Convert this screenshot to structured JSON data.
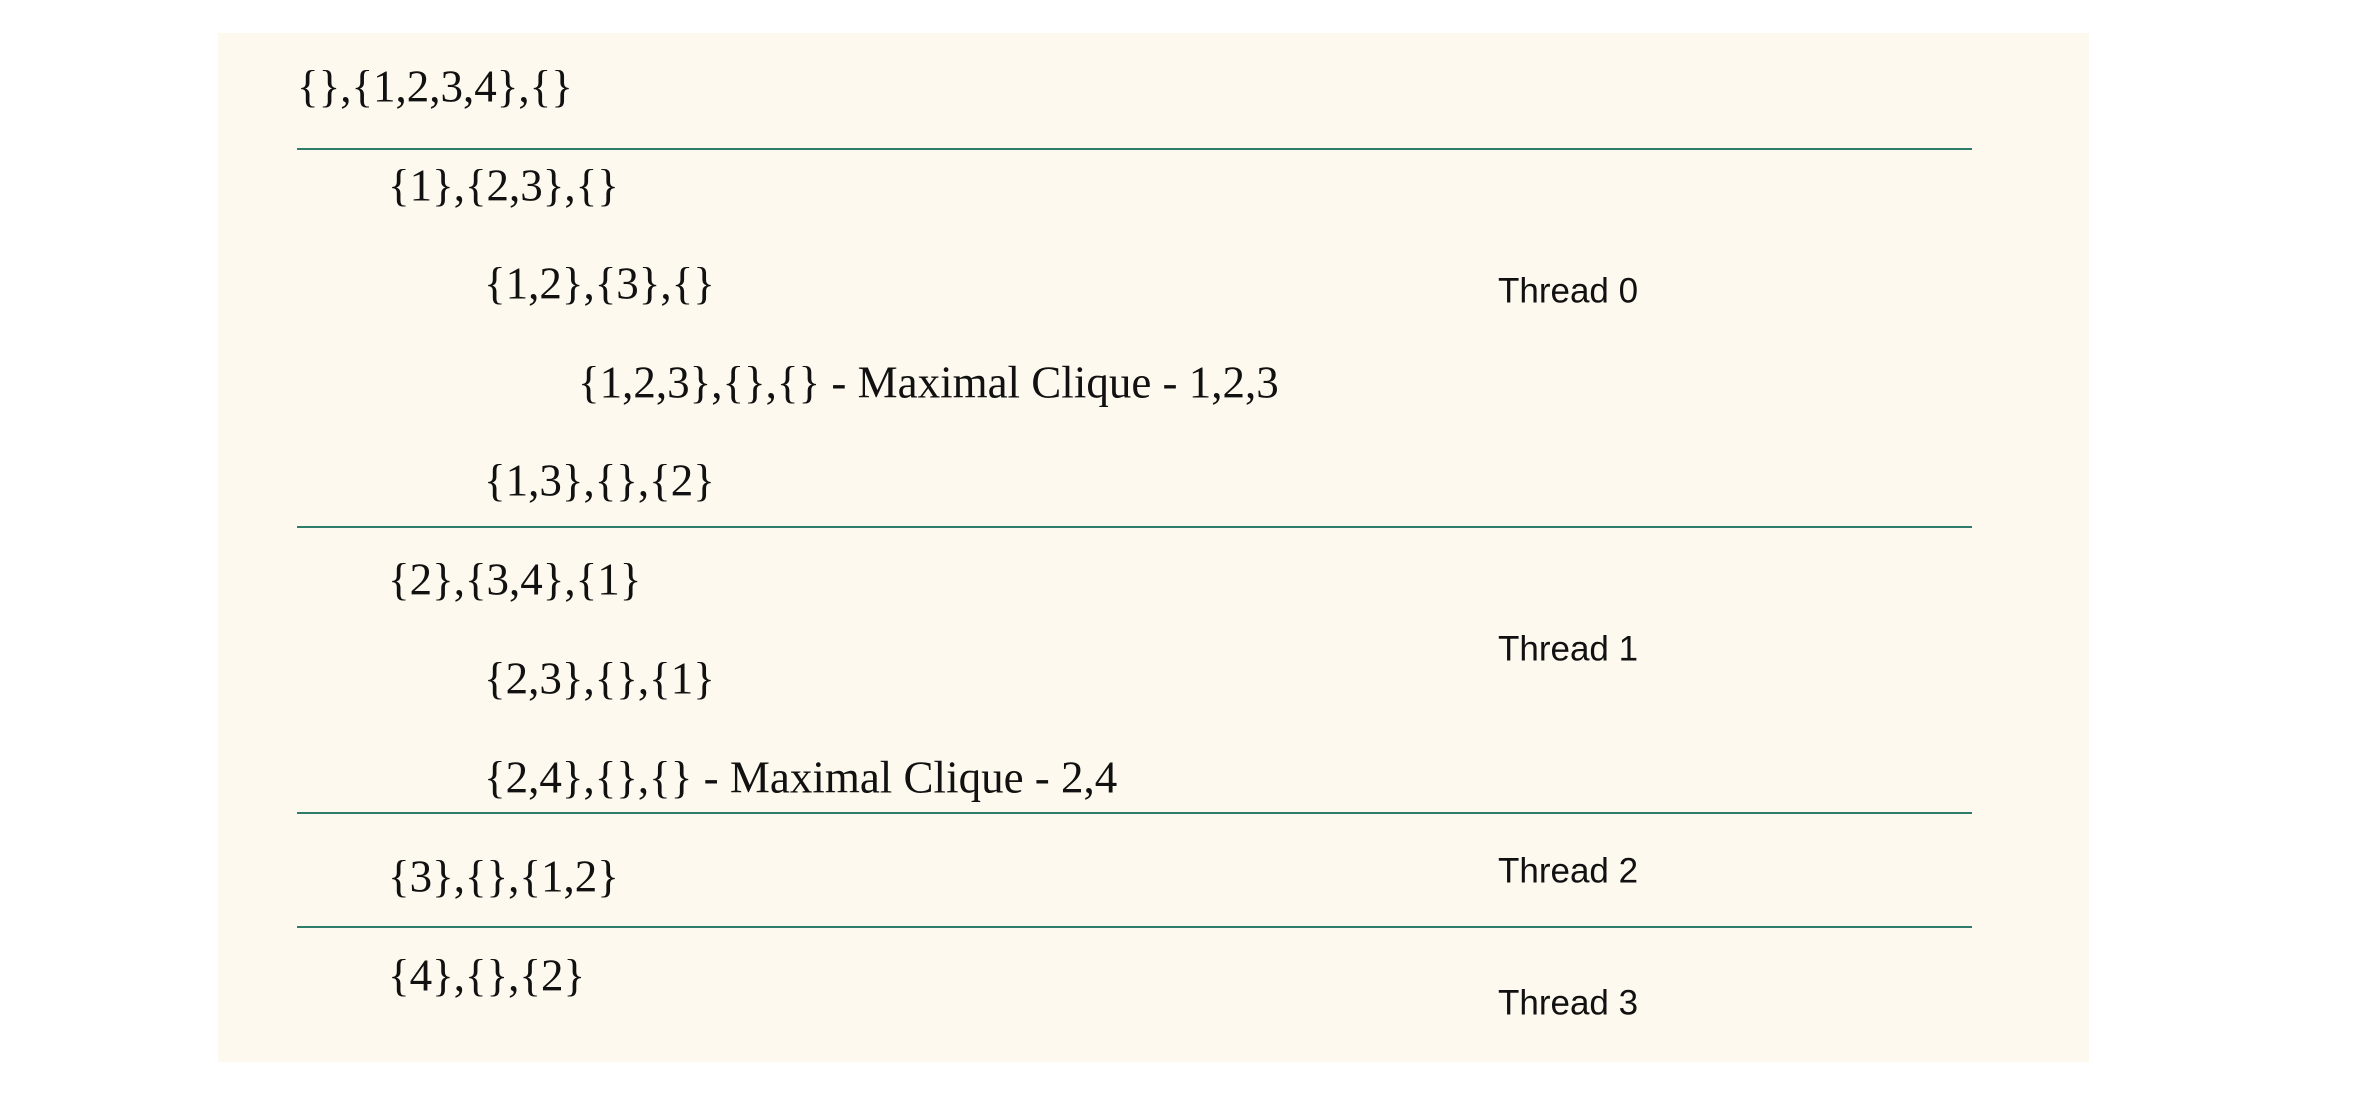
{
  "rows": [
    "{},{1,2,3,4},{}",
    "{1},{2,3},{}",
    "{1,2},{3},{}",
    "{1,2,3},{},{} - Maximal Clique - 1,2,3",
    "{1,3},{},{2}",
    "{2},{3,4},{1}",
    "{2,3},{},{1}",
    "{2,4},{},{} - Maximal Clique - 2,4",
    "{3},{},{1,2}",
    "{4},{},{2}"
  ],
  "threads": [
    "Thread 0",
    "Thread 1",
    "Thread 2",
    "Thread 3"
  ],
  "colors": {
    "background": "#fdf9ee",
    "separator": "#2e7d6b"
  }
}
